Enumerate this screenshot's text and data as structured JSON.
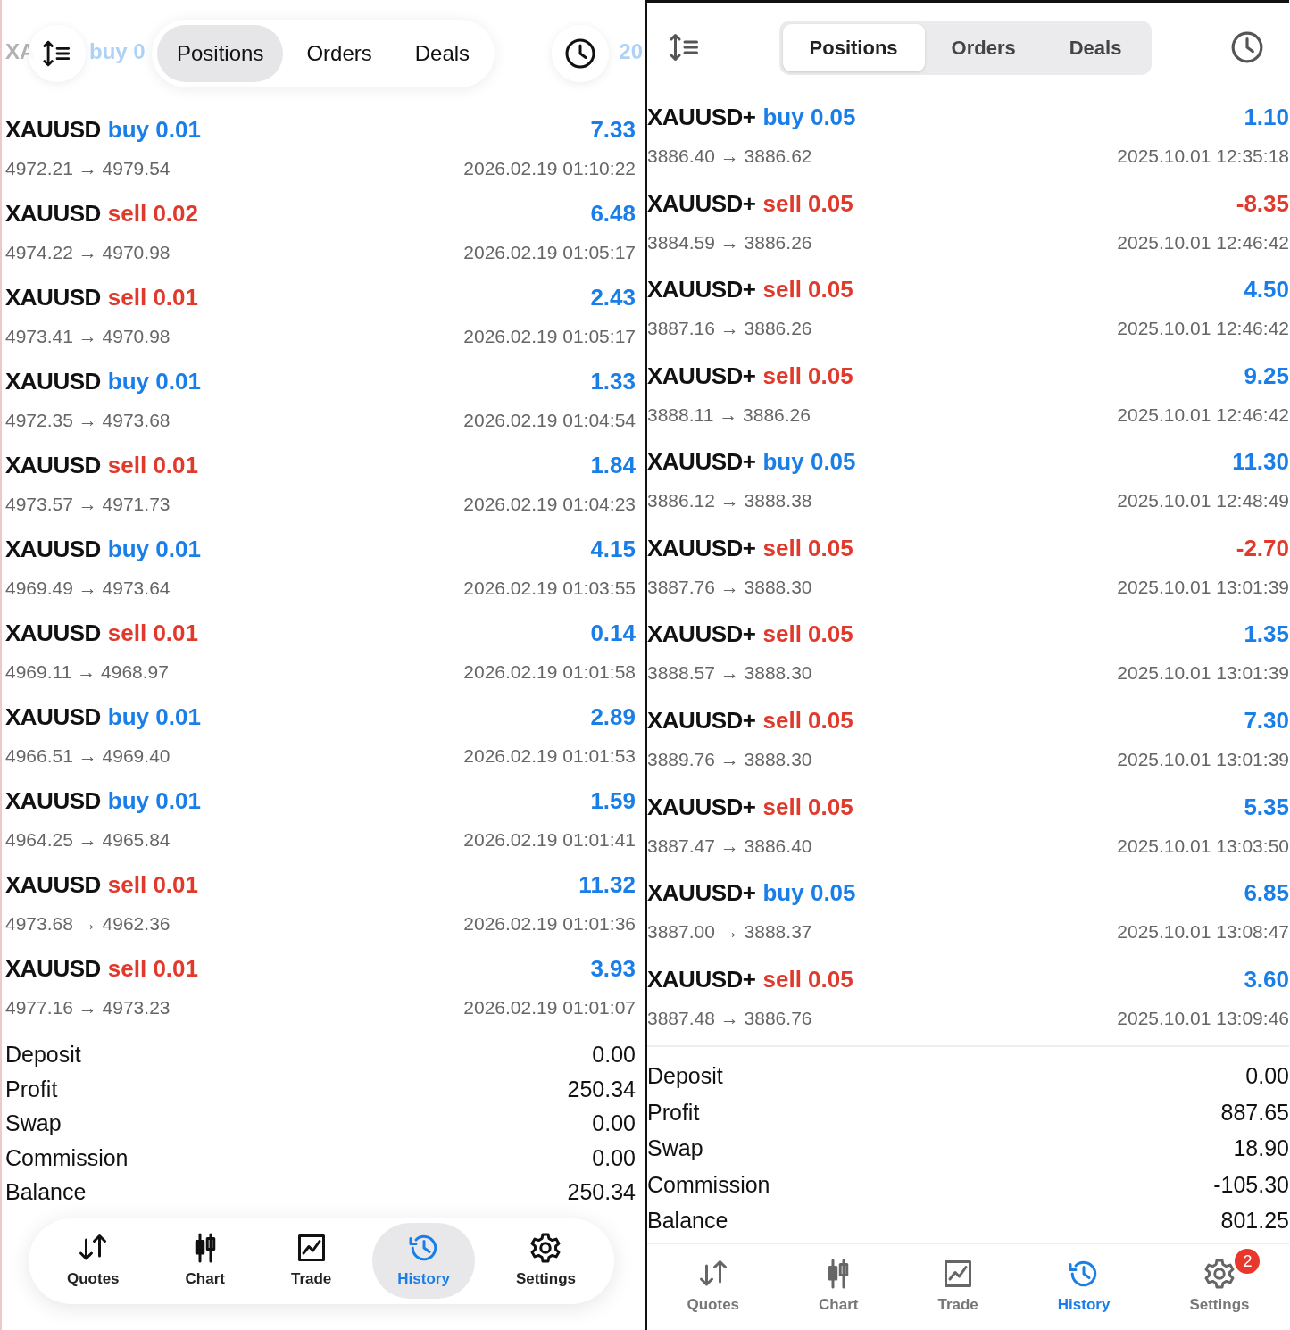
{
  "panels": [
    {
      "kind": "floating",
      "peek_row": {
        "symbol": "XA",
        "order": "buy 0",
        "profit": "20"
      },
      "tabs": [
        {
          "label": "Positions",
          "selected": true
        },
        {
          "label": "Orders",
          "selected": false
        },
        {
          "label": "Deals",
          "selected": false
        }
      ],
      "trades": [
        {
          "symbol": "XAUUSD",
          "kind": "buy",
          "order": "buy 0.01",
          "profit": "7.33",
          "loss": false,
          "prices": "4972.21 → 4979.54",
          "time": "2026.02.19 01:10:22"
        },
        {
          "symbol": "XAUUSD",
          "kind": "sell",
          "order": "sell 0.02",
          "profit": "6.48",
          "loss": false,
          "prices": "4974.22 → 4970.98",
          "time": "2026.02.19 01:05:17"
        },
        {
          "symbol": "XAUUSD",
          "kind": "sell",
          "order": "sell 0.01",
          "profit": "2.43",
          "loss": false,
          "prices": "4973.41 → 4970.98",
          "time": "2026.02.19 01:05:17"
        },
        {
          "symbol": "XAUUSD",
          "kind": "buy",
          "order": "buy 0.01",
          "profit": "1.33",
          "loss": false,
          "prices": "4972.35 → 4973.68",
          "time": "2026.02.19 01:04:54"
        },
        {
          "symbol": "XAUUSD",
          "kind": "sell",
          "order": "sell 0.01",
          "profit": "1.84",
          "loss": false,
          "prices": "4973.57 → 4971.73",
          "time": "2026.02.19 01:04:23"
        },
        {
          "symbol": "XAUUSD",
          "kind": "buy",
          "order": "buy 0.01",
          "profit": "4.15",
          "loss": false,
          "prices": "4969.49 → 4973.64",
          "time": "2026.02.19 01:03:55"
        },
        {
          "symbol": "XAUUSD",
          "kind": "sell",
          "order": "sell 0.01",
          "profit": "0.14",
          "loss": false,
          "prices": "4969.11 → 4968.97",
          "time": "2026.02.19 01:01:58"
        },
        {
          "symbol": "XAUUSD",
          "kind": "buy",
          "order": "buy 0.01",
          "profit": "2.89",
          "loss": false,
          "prices": "4966.51 → 4969.40",
          "time": "2026.02.19 01:01:53"
        },
        {
          "symbol": "XAUUSD",
          "kind": "buy",
          "order": "buy 0.01",
          "profit": "1.59",
          "loss": false,
          "prices": "4964.25 → 4965.84",
          "time": "2026.02.19 01:01:41"
        },
        {
          "symbol": "XAUUSD",
          "kind": "sell",
          "order": "sell 0.01",
          "profit": "11.32",
          "loss": false,
          "prices": "4973.68 → 4962.36",
          "time": "2026.02.19 01:01:36"
        },
        {
          "symbol": "XAUUSD",
          "kind": "sell",
          "order": "sell 0.01",
          "profit": "3.93",
          "loss": false,
          "prices": "4977.16 → 4973.23",
          "time": "2026.02.19 01:01:07"
        }
      ],
      "summary": [
        {
          "label": "Deposit",
          "value": "0.00"
        },
        {
          "label": "Profit",
          "value": "250.34"
        },
        {
          "label": "Swap",
          "value": "0.00"
        },
        {
          "label": "Commission",
          "value": "0.00"
        },
        {
          "label": "Balance",
          "value": "250.34"
        }
      ],
      "nav": [
        {
          "label": "Quotes",
          "selected": false
        },
        {
          "label": "Chart",
          "selected": false
        },
        {
          "label": "Trade",
          "selected": false
        },
        {
          "label": "History",
          "selected": true
        },
        {
          "label": "Settings",
          "selected": false
        }
      ]
    },
    {
      "kind": "flat",
      "tabs": [
        {
          "label": "Positions",
          "selected": true
        },
        {
          "label": "Orders",
          "selected": false
        },
        {
          "label": "Deals",
          "selected": false
        }
      ],
      "trades": [
        {
          "symbol": "XAUUSD+",
          "kind": "buy",
          "order": "buy 0.05",
          "profit": "1.10",
          "loss": false,
          "prices": "3886.40 → 3886.62",
          "time": "2025.10.01 12:35:18"
        },
        {
          "symbol": "XAUUSD+",
          "kind": "sell",
          "order": "sell 0.05",
          "profit": "-8.35",
          "loss": true,
          "prices": "3884.59 → 3886.26",
          "time": "2025.10.01 12:46:42"
        },
        {
          "symbol": "XAUUSD+",
          "kind": "sell",
          "order": "sell 0.05",
          "profit": "4.50",
          "loss": false,
          "prices": "3887.16 → 3886.26",
          "time": "2025.10.01 12:46:42"
        },
        {
          "symbol": "XAUUSD+",
          "kind": "sell",
          "order": "sell 0.05",
          "profit": "9.25",
          "loss": false,
          "prices": "3888.11 → 3886.26",
          "time": "2025.10.01 12:46:42"
        },
        {
          "symbol": "XAUUSD+",
          "kind": "buy",
          "order": "buy 0.05",
          "profit": "11.30",
          "loss": false,
          "prices": "3886.12 → 3888.38",
          "time": "2025.10.01 12:48:49"
        },
        {
          "symbol": "XAUUSD+",
          "kind": "sell",
          "order": "sell 0.05",
          "profit": "-2.70",
          "loss": true,
          "prices": "3887.76 → 3888.30",
          "time": "2025.10.01 13:01:39"
        },
        {
          "symbol": "XAUUSD+",
          "kind": "sell",
          "order": "sell 0.05",
          "profit": "1.35",
          "loss": false,
          "prices": "3888.57 → 3888.30",
          "time": "2025.10.01 13:01:39"
        },
        {
          "symbol": "XAUUSD+",
          "kind": "sell",
          "order": "sell 0.05",
          "profit": "7.30",
          "loss": false,
          "prices": "3889.76 → 3888.30",
          "time": "2025.10.01 13:01:39"
        },
        {
          "symbol": "XAUUSD+",
          "kind": "sell",
          "order": "sell 0.05",
          "profit": "5.35",
          "loss": false,
          "prices": "3887.47 → 3886.40",
          "time": "2025.10.01 13:03:50"
        },
        {
          "symbol": "XAUUSD+",
          "kind": "buy",
          "order": "buy 0.05",
          "profit": "6.85",
          "loss": false,
          "prices": "3887.00 → 3888.37",
          "time": "2025.10.01 13:08:47"
        },
        {
          "symbol": "XAUUSD+",
          "kind": "sell",
          "order": "sell 0.05",
          "profit": "3.60",
          "loss": false,
          "prices": "3887.48 → 3886.76",
          "time": "2025.10.01 13:09:46"
        }
      ],
      "summary": [
        {
          "label": "Deposit",
          "value": "0.00"
        },
        {
          "label": "Profit",
          "value": "887.65"
        },
        {
          "label": "Swap",
          "value": "18.90"
        },
        {
          "label": "Commission",
          "value": "-105.30"
        },
        {
          "label": "Balance",
          "value": "801.25"
        }
      ],
      "nav": [
        {
          "label": "Quotes",
          "selected": false
        },
        {
          "label": "Chart",
          "selected": false
        },
        {
          "label": "Trade",
          "selected": false
        },
        {
          "label": "History",
          "selected": true
        },
        {
          "label": "Settings",
          "selected": false,
          "badge": "2"
        }
      ]
    }
  ]
}
